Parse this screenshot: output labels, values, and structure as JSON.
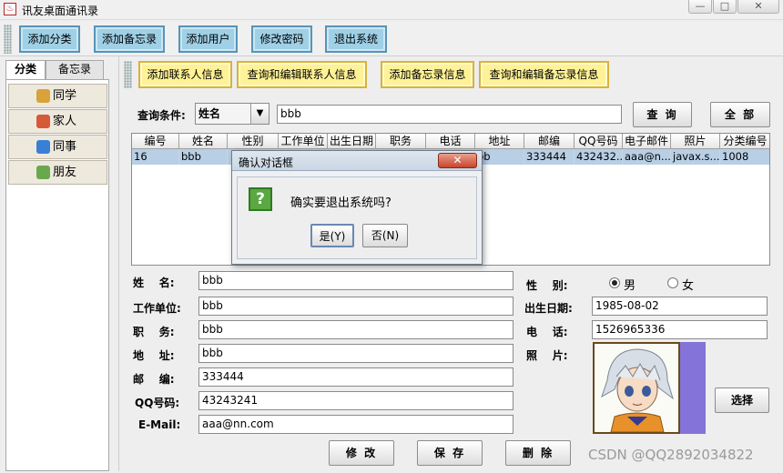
{
  "window": {
    "title": "讯友桌面通讯录",
    "app_icon": "java-icon",
    "min": "—",
    "max": "□",
    "close": "✕"
  },
  "toolbar": {
    "buttons": [
      "添加分类",
      "添加备忘录",
      "添加用户",
      "修改密码",
      "退出系统"
    ]
  },
  "left_tabs": [
    "分类",
    "备忘录"
  ],
  "categories": [
    {
      "label": "同学",
      "icon": "classmates-icon",
      "color": "#d9a23a"
    },
    {
      "label": "家人",
      "icon": "family-icon",
      "color": "#d65a3a"
    },
    {
      "label": "同事",
      "icon": "colleagues-icon",
      "color": "#3a7fd6"
    },
    {
      "label": "朋友",
      "icon": "friends-icon",
      "color": "#6aa84f"
    }
  ],
  "right_toolbar": {
    "buttons": [
      "添加联系人信息",
      "查询和编辑联系人信息",
      "添加备忘录信息",
      "查询和编辑备忘录信息"
    ]
  },
  "query": {
    "label": "查询条件:",
    "select_value": "姓名",
    "input_value": "bbb",
    "query_button": "查 询",
    "all_button": "全 部"
  },
  "table": {
    "headers": [
      "编号",
      "姓名",
      "性别",
      "工作单位",
      "出生日期",
      "职务",
      "电话",
      "地址",
      "邮编",
      "QQ号码",
      "电子邮件",
      "照片",
      "分类编号"
    ],
    "rows": [
      [
        "16",
        "bbb",
        "",
        "",
        "",
        "",
        "",
        "bb",
        "333444",
        "432432...",
        "aaa@n...",
        "javax.s...",
        "1008"
      ]
    ]
  },
  "dialog": {
    "title": "确认对话框",
    "message": "确实要退出系统吗?",
    "icon": "question-icon",
    "icon_glyph": "?",
    "yes": "是(Y)",
    "no": "否(N)",
    "close": "✕"
  },
  "form": {
    "name_label": "姓    名:",
    "name": "bbb",
    "work_label": "工作单位:",
    "work": "bbb",
    "job_label": "职    务:",
    "job": "bbb",
    "addr_label": "地    址:",
    "addr": "bbb",
    "zip_label": "邮    编:",
    "zip": "333444",
    "qq_label": "QQ号码:",
    "qq": "43243241",
    "email_label": "E-Mail:",
    "email": "aaa@nn.com",
    "gender_label": "性    别:",
    "male": "男",
    "female": "女",
    "gender_selected": "男",
    "birth_label": "出生日期:",
    "birth": "1985-08-02",
    "phone_label": "电    话:",
    "phone": "1526965336",
    "photo_label": "照    片:",
    "photo_icon": "avatar-photo",
    "select_button": "选择",
    "modify_button": "修 改",
    "save_button": "保 存",
    "delete_button": "删 除"
  },
  "watermark": "CSDN @QQ2892034822"
}
